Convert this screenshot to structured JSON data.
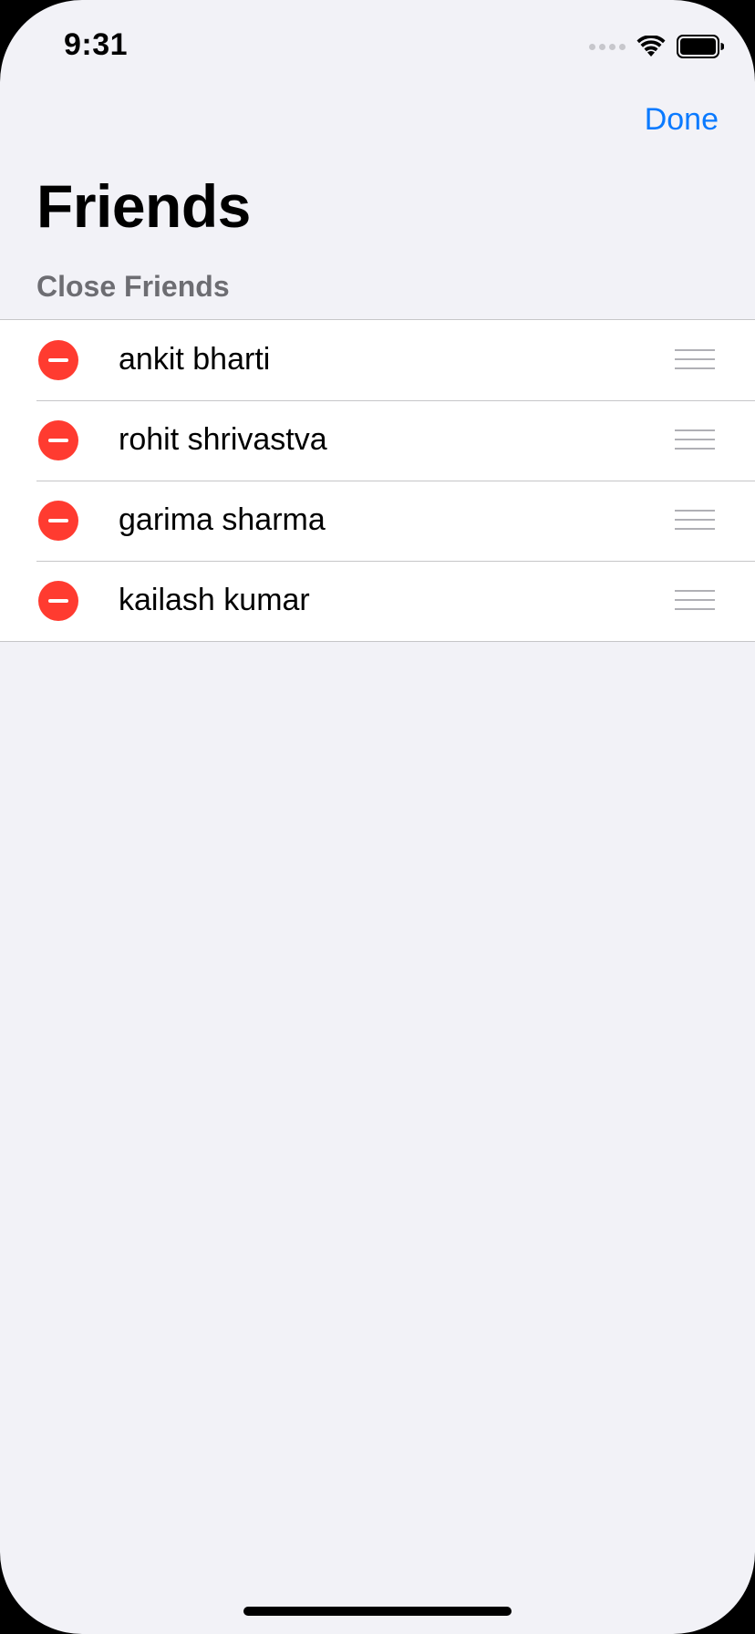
{
  "status_bar": {
    "time": "9:31",
    "icons": [
      "cellular-signal-icon",
      "wifi-icon",
      "battery-icon"
    ]
  },
  "nav": {
    "done_label": "Done",
    "title": "Friends"
  },
  "section": {
    "header": "Close Friends",
    "friends": [
      {
        "name": "ankit bharti"
      },
      {
        "name": "rohit shrivastva"
      },
      {
        "name": "garima sharma"
      },
      {
        "name": "kailash kumar"
      }
    ]
  },
  "colors": {
    "background": "#f2f2f7",
    "accent": "#0a7aff",
    "delete": "#ff3b30",
    "separator": "#c6c6c8",
    "secondary_text": "#6d6d72"
  }
}
